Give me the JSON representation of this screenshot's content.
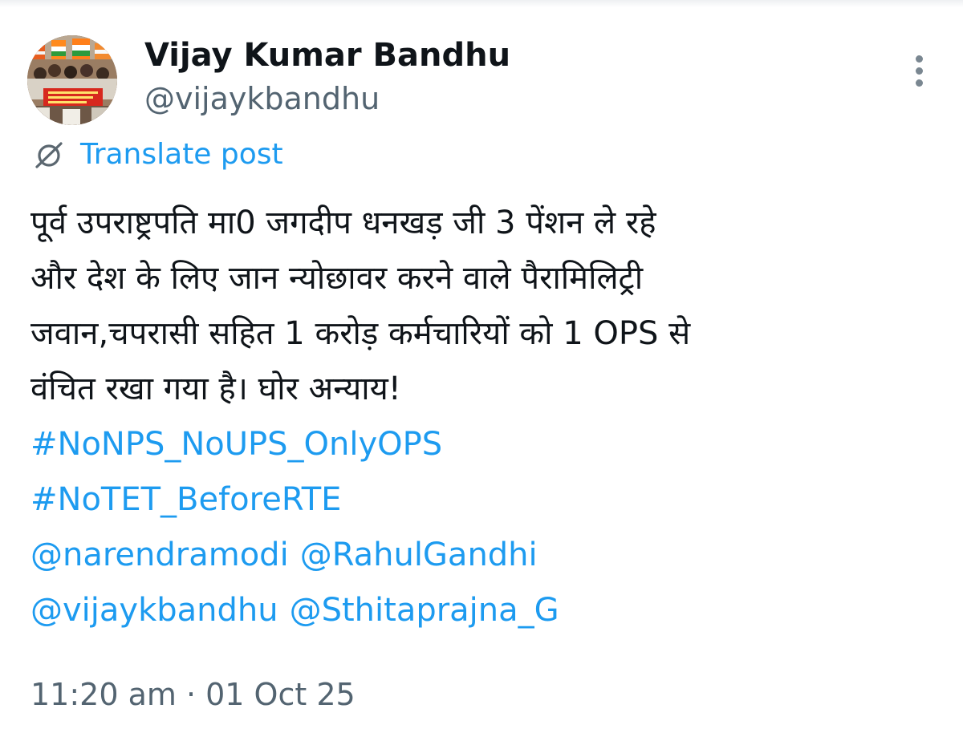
{
  "author": {
    "display_name": "Vijay Kumar Bandhu",
    "handle": "@vijaykbandhu"
  },
  "icons": {
    "more": "more-options-vertical-icon",
    "translate": "translate-globe-icon"
  },
  "translate_label": "Translate post",
  "post_lines": [
    "पूर्व उपराष्ट्रपति मा0 जगदीप धनखड़ जी 3 पेंशन ले रहे",
    "और देश के लिए जान न्योछावर करने वाले पैरामिलिट्री",
    "जवान,चपरासी सहित 1 करोड़ कर्मचारियों को 1 OPS से",
    "वंचित रखा गया है। घोर अन्याय!"
  ],
  "hashtags": [
    "#NoNPS_NoUPS_OnlyOPS",
    "#NoTET_BeforeRTE"
  ],
  "mentions": [
    "@narendramodi",
    "@RahulGandhi",
    "@vijaykbandhu",
    "@Sthitaprajna_G"
  ],
  "timestamp": "11:20 am · 01 Oct 25",
  "colors": {
    "link": "#1d9bf0",
    "text": "#0f1419",
    "secondary": "#536471"
  }
}
